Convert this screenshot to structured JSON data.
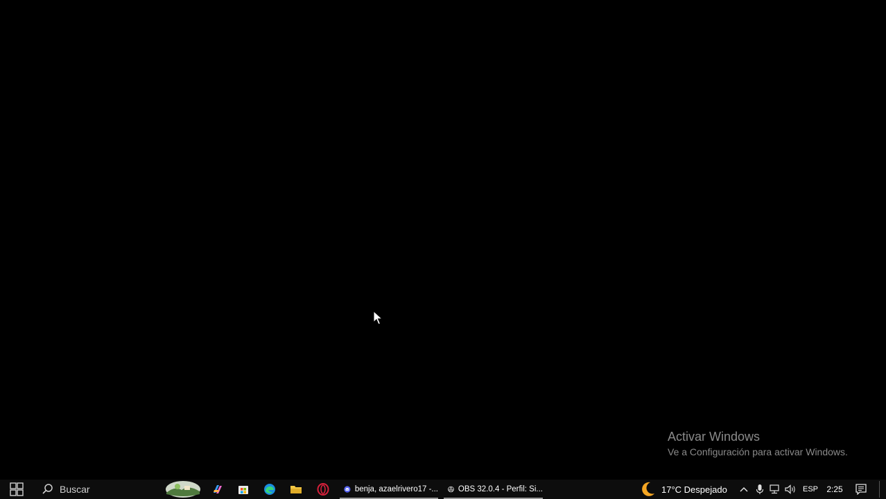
{
  "watermark": {
    "title": "Activar Windows",
    "subtitle": "Ve a Configuración para activar Windows."
  },
  "taskbar": {
    "start_icon": "windows-start-icon",
    "search_placeholder": "Buscar",
    "pinned": [
      {
        "name": "news-widget-icon"
      },
      {
        "name": "copilot-icon"
      },
      {
        "name": "microsoft-store-icon"
      },
      {
        "name": "edge-icon"
      },
      {
        "name": "file-explorer-icon"
      },
      {
        "name": "opera-icon"
      }
    ],
    "open_apps": [
      {
        "name": "discord-icon",
        "label": "benja, azaelrivero17 -..."
      },
      {
        "name": "obs-icon",
        "label": "OBS 32.0.4 - Perfil: Si..."
      }
    ],
    "weather": {
      "icon": "moon-icon",
      "text": "17°C  Despejado"
    },
    "tray": {
      "language": "ESP",
      "time": "2:25"
    },
    "colors": {
      "taskbar": "#0d0d0d",
      "discord": "#5865F2",
      "opera": "#d6203b",
      "explorer": "#f2c744",
      "edge": "#1b8de0"
    }
  }
}
